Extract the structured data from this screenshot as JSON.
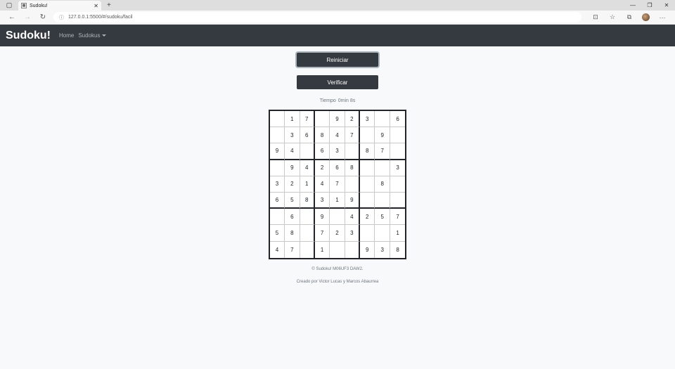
{
  "browser": {
    "tab_title": "Sudoku!",
    "url": "127.0.0.1:5500/#/sudoku/facil"
  },
  "navbar": {
    "brand": "Sudoku!",
    "home_label": "Home",
    "sudokus_label": "Sudokus"
  },
  "buttons": {
    "restart_label": "Reiniciar",
    "verify_label": "Verificar"
  },
  "timer": {
    "label": "Tiempo",
    "value": "0min 8s"
  },
  "board": [
    [
      "",
      "1",
      "7",
      "",
      "9",
      "2",
      "3",
      "",
      "6"
    ],
    [
      "",
      "3",
      "6",
      "8",
      "4",
      "7",
      "",
      "9",
      ""
    ],
    [
      "9",
      "4",
      "",
      "6",
      "3",
      "",
      "8",
      "7",
      ""
    ],
    [
      "",
      "9",
      "4",
      "2",
      "6",
      "8",
      "",
      "",
      "3"
    ],
    [
      "3",
      "2",
      "1",
      "4",
      "7",
      "",
      "",
      "8",
      ""
    ],
    [
      "6",
      "5",
      "8",
      "3",
      "1",
      "9",
      "",
      "",
      ""
    ],
    [
      "",
      "6",
      "",
      "9",
      "",
      "4",
      "2",
      "5",
      "7"
    ],
    [
      "5",
      "8",
      "",
      "7",
      "2",
      "3",
      "",
      "",
      "1"
    ],
    [
      "4",
      "7",
      "",
      "1",
      "",
      "",
      "9",
      "3",
      "8"
    ]
  ],
  "footer": {
    "copyright": "© Sudoku! M06UF3 DAW2.",
    "credits": "Creado por Victor Lucas y Marcos Abaurrea"
  }
}
